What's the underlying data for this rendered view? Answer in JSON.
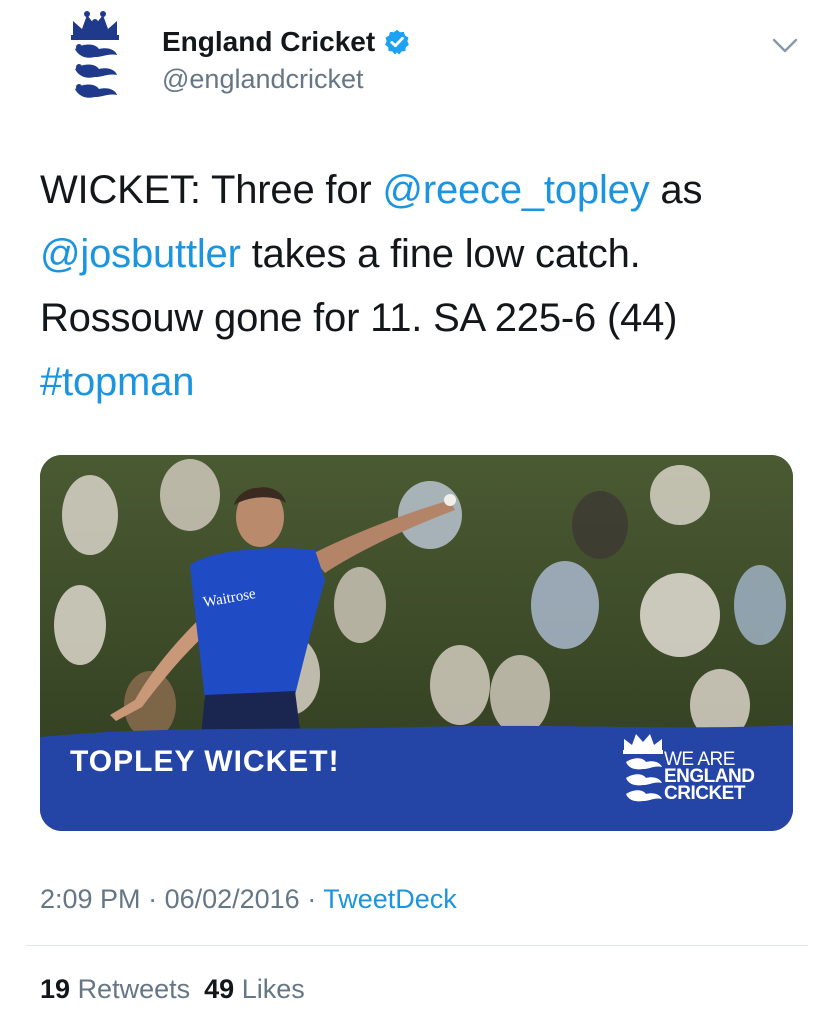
{
  "author": {
    "display_name": "England Cricket",
    "handle": "@englandcricket",
    "verified": true,
    "avatar_icon": "three-lions-crest-icon"
  },
  "tweet": {
    "segments": [
      {
        "text": "WICKET: Three for ",
        "type": "text"
      },
      {
        "text": "@reece_topley",
        "type": "mention"
      },
      {
        "text": " as ",
        "type": "text"
      },
      {
        "text": "@josbuttler",
        "type": "mention"
      },
      {
        "text": " takes a fine low catch. Rossouw gone for 11. SA 225-6 (44) ",
        "type": "text"
      },
      {
        "text": "#topman",
        "type": "hashtag"
      }
    ]
  },
  "media": {
    "banner_text": "TOPLEY WICKET!",
    "brand_line1": "WE ARE",
    "brand_line2": "ENGLAND",
    "brand_line3": "CRICKET",
    "shirt_sponsor": "Waitrose",
    "banner_color": "#2545a6"
  },
  "meta": {
    "time": "2:09 PM",
    "separator": " · ",
    "date": "06/02/2016",
    "source": "TweetDeck"
  },
  "stats": {
    "retweets_count": "19",
    "retweets_label": "Retweets",
    "likes_count": "49",
    "likes_label": "Likes"
  },
  "colors": {
    "link": "#1b95e0",
    "text": "#14171a",
    "secondary": "#657786",
    "verified": "#1da1f2"
  }
}
